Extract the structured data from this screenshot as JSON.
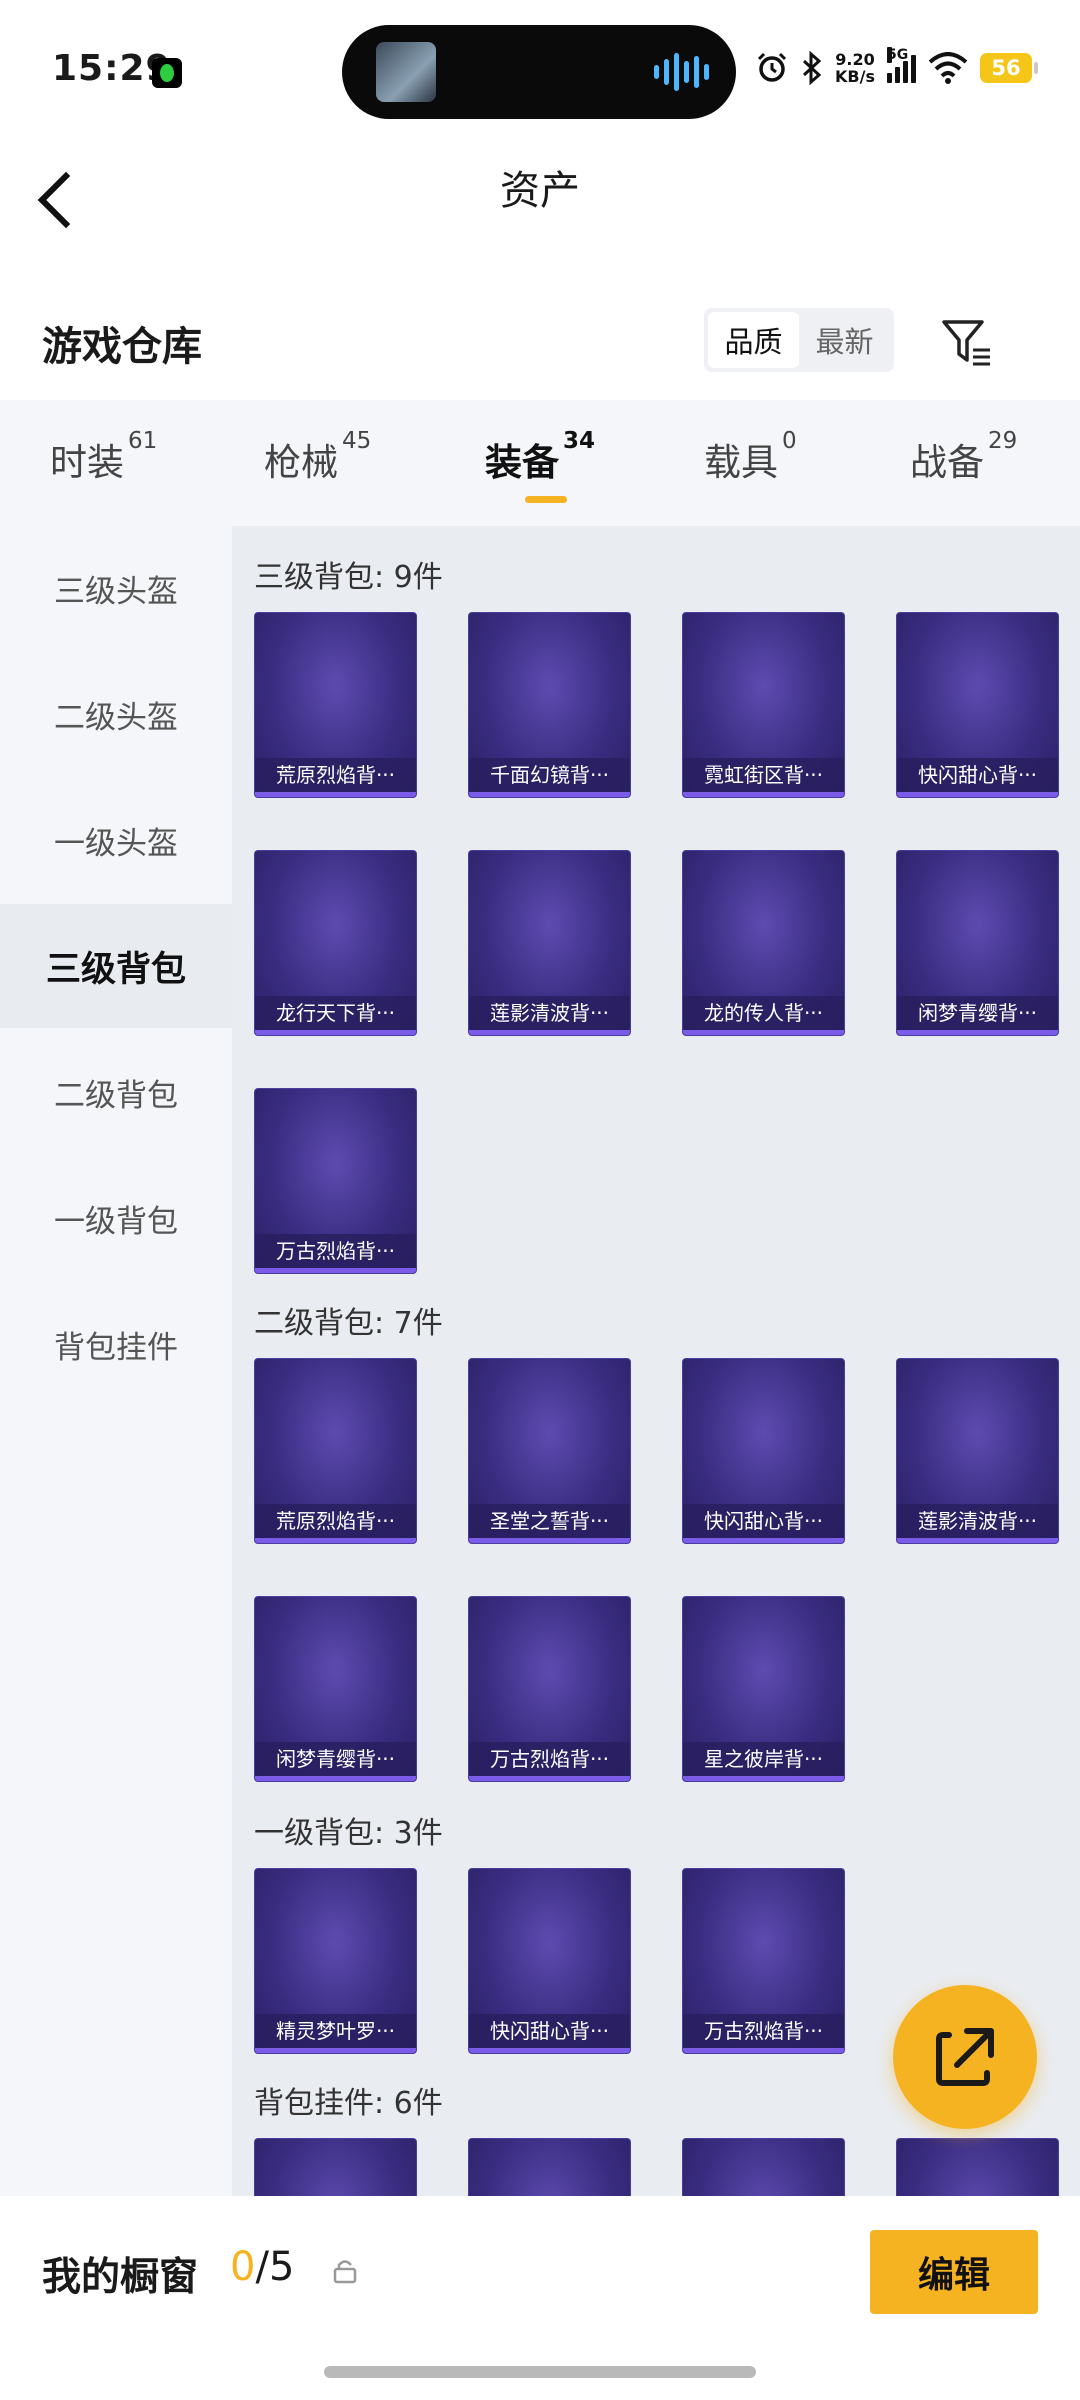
{
  "status_bar": {
    "time": "15:29",
    "net_speed_top": "9.20",
    "net_speed_bottom": "KB/s",
    "network": "5G",
    "battery": "56",
    "icons": [
      "alarm-icon",
      "bluetooth-icon",
      "signal-icon",
      "wifi-icon",
      "battery-icon"
    ]
  },
  "header": {
    "title": "资产",
    "back_icon": "chevron-left-icon"
  },
  "warehouse": {
    "title": "游戏仓库",
    "sort_options": [
      "品质",
      "最新"
    ],
    "sort_selected": "品质",
    "filter_icon": "filter-icon"
  },
  "tabs": [
    {
      "label": "时装",
      "count": "61"
    },
    {
      "label": "枪械",
      "count": "45"
    },
    {
      "label": "装备",
      "count": "34",
      "active": true
    },
    {
      "label": "载具",
      "count": "0"
    },
    {
      "label": "战备",
      "count": "29"
    }
  ],
  "sidebar": {
    "items": [
      "三级头盔",
      "二级头盔",
      "一级头盔",
      "三级背包",
      "二级背包",
      "一级背包",
      "背包挂件"
    ],
    "active": "三级背包"
  },
  "sections": [
    {
      "header": "三级背包: 9件",
      "items": [
        "荒原烈焰背···",
        "千面幻镜背···",
        "霓虹街区背···",
        "快闪甜心背···",
        "龙行天下背···",
        "莲影清波背···",
        "龙的传人背···",
        "闲梦青缨背···",
        "万古烈焰背···"
      ]
    },
    {
      "header": "二级背包: 7件",
      "items": [
        "荒原烈焰背···",
        "圣堂之誓背···",
        "快闪甜心背···",
        "莲影清波背···",
        "闲梦青缨背···",
        "万古烈焰背···",
        "星之彼岸背···"
      ]
    },
    {
      "header": "一级背包: 3件",
      "items": [
        "精灵梦叶罗···",
        "快闪甜心背···",
        "万古烈焰背···"
      ]
    },
    {
      "header": "背包挂件: 6件",
      "items": [
        "",
        "",
        "",
        ""
      ]
    }
  ],
  "bottom_bar": {
    "showcase_label": "我的橱窗",
    "used": "0",
    "separator": "/",
    "total": "5",
    "edit_label": "编辑"
  },
  "colors": {
    "accent": "#f5b321",
    "card_bg": "#3a2d82",
    "card_border": "#7a5ce8"
  }
}
